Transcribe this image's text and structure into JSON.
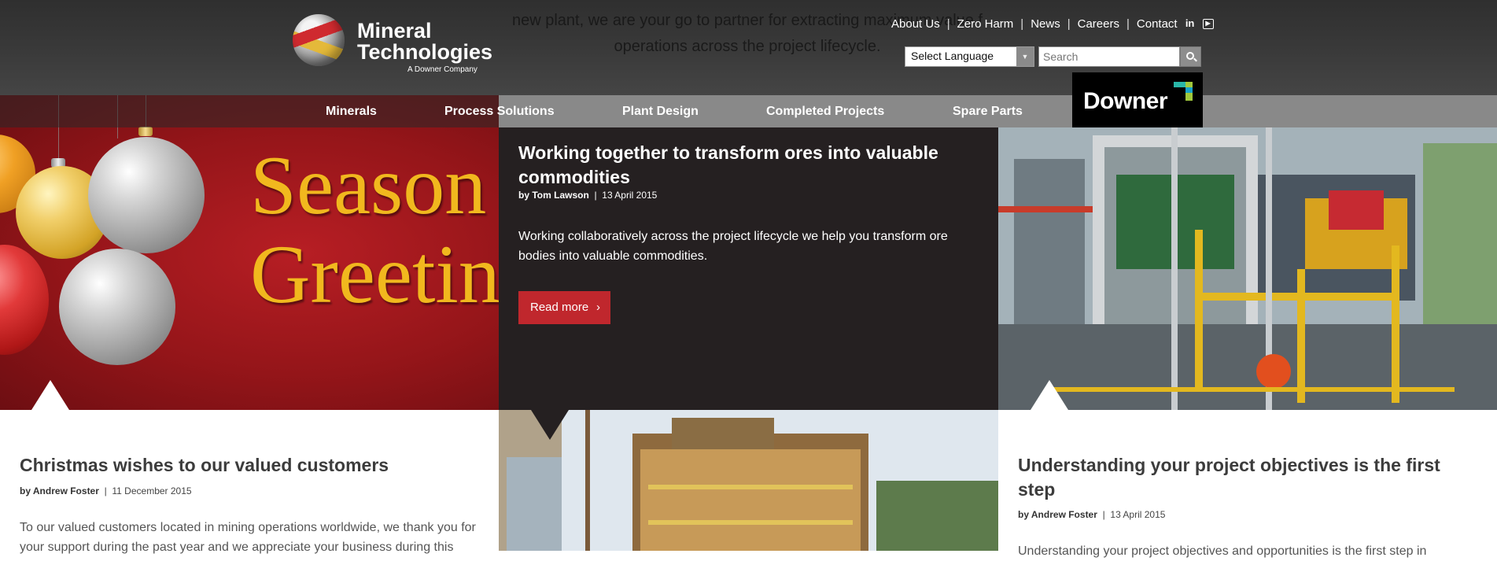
{
  "header": {
    "ghost_text_line1": "new plant, we are your go to partner for extracting maximum value f",
    "ghost_text_line2": "operations across the project lifecycle.",
    "logo": {
      "line1": "Mineral",
      "line2": "Technologies",
      "tagline": "A Downer Company"
    },
    "top_links": [
      "About Us",
      "Zero Harm",
      "News",
      "Careers",
      "Contact"
    ],
    "social_icons": [
      "linkedin-icon",
      "youtube-icon"
    ],
    "language_select": "Select Language",
    "search_placeholder": "Search"
  },
  "main_nav": [
    "Minerals",
    "Process Solutions",
    "Plant Design",
    "Completed Projects",
    "Spare Parts"
  ],
  "partner_logo": "Downer",
  "hero_left": {
    "line1": "Season",
    "line2": "Greetin"
  },
  "featured": {
    "title": "Working together to transform ores into valuable commodities",
    "author": "by Tom Lawson",
    "date": "13 April 2015",
    "body": "Working collaboratively across the project lifecycle we help you transform ore bodies into valuable commodities.",
    "button": "Read more",
    "button_icon": "chevron-right-icon"
  },
  "cards": [
    {
      "title": "Christmas wishes to our valued customers",
      "author": "by Andrew Foster",
      "date": "11 December 2015",
      "body": "To our valued customers located in mining operations worldwide, we thank you for your support during the past year and we appreciate your business during this"
    },
    {
      "title": "Understanding your project objectives is the first step",
      "author": "by Andrew Foster",
      "date": "13 April 2015",
      "body": "Understanding your project objectives and opportunities is the first step in"
    }
  ],
  "colors": {
    "accent": "#c0272d",
    "dark_panel": "#252021",
    "header": "#3a3a3a",
    "gold_text": "#f1b81e"
  }
}
